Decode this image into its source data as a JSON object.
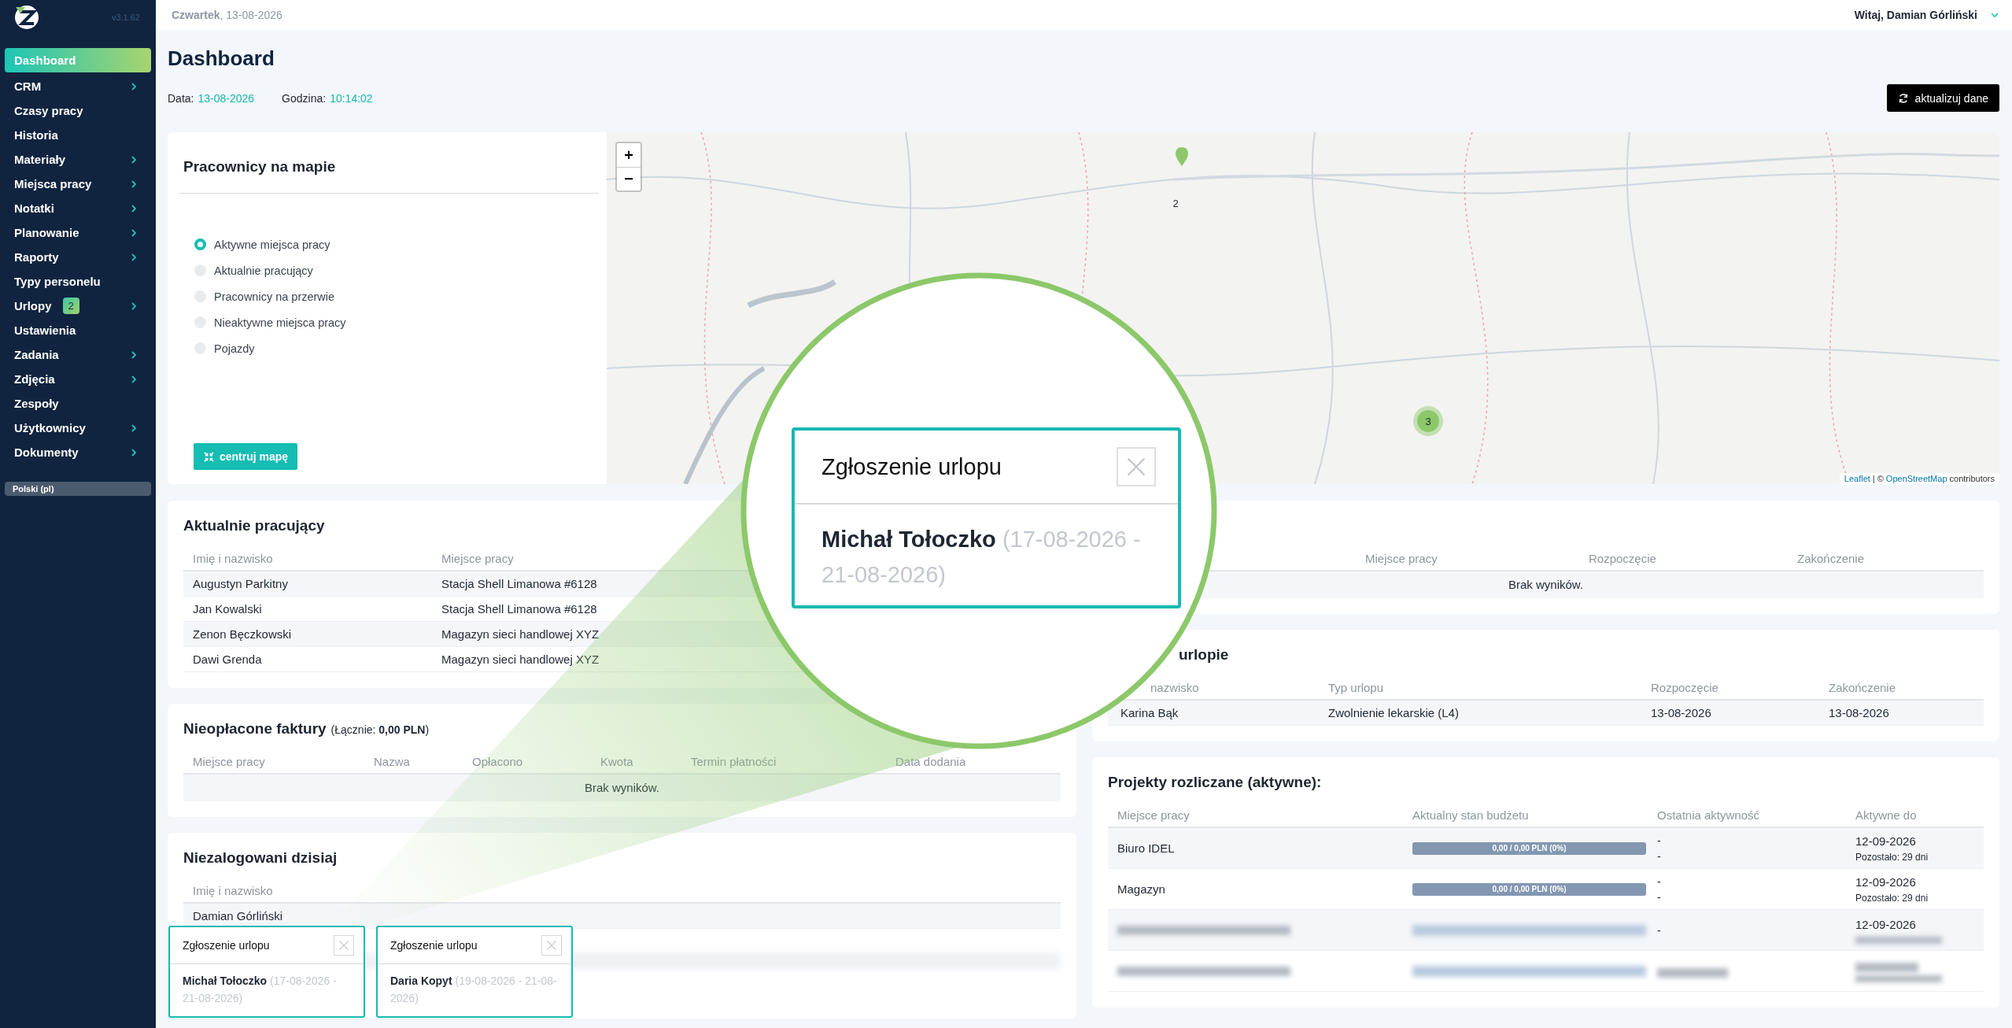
{
  "sidebar": {
    "version": "v3.1.62",
    "items": [
      {
        "label": "Dashboard",
        "selected": true,
        "submenu": false
      },
      {
        "label": "CRM",
        "selected": false,
        "submenu": true
      },
      {
        "label": "Czasy pracy",
        "selected": false,
        "submenu": false
      },
      {
        "label": "Historia",
        "selected": false,
        "submenu": false
      },
      {
        "label": "Materiały",
        "selected": false,
        "submenu": true
      },
      {
        "label": "Miejsca pracy",
        "selected": false,
        "submenu": true
      },
      {
        "label": "Notatki",
        "selected": false,
        "submenu": true
      },
      {
        "label": "Planowanie",
        "selected": false,
        "submenu": true
      },
      {
        "label": "Raporty",
        "selected": false,
        "submenu": true
      },
      {
        "label": "Typy personelu",
        "selected": false,
        "submenu": false
      },
      {
        "label": "Urlopy",
        "selected": false,
        "submenu": true,
        "badge": "2"
      },
      {
        "label": "Ustawienia",
        "selected": false,
        "submenu": false
      },
      {
        "label": "Zadania",
        "selected": false,
        "submenu": true
      },
      {
        "label": "Zdjęcia",
        "selected": false,
        "submenu": true
      },
      {
        "label": "Zespoły",
        "selected": false,
        "submenu": false
      },
      {
        "label": "Użytkownicy",
        "selected": false,
        "submenu": true
      },
      {
        "label": "Dokumenty",
        "selected": false,
        "submenu": true
      }
    ],
    "language": "Polski (pl)"
  },
  "topbar": {
    "date": "**Czwartek**, 13-08-2026",
    "greeting": "Witaj, Damian Górliński"
  },
  "page": {
    "title": "Dashboard",
    "date_label": "Data:",
    "date_value": "13-08-2026",
    "time_label": "Godzina:",
    "time_value": "10:14:02",
    "refresh_button": "aktualizuj dane"
  },
  "map_panel": {
    "title": "Pracownicy na mapie",
    "filters": [
      {
        "label": "Aktywne miejsca pracy",
        "selected": true
      },
      {
        "label": "Aktualnie pracujący",
        "selected": false
      },
      {
        "label": "Pracownicy na przerwie",
        "selected": false
      },
      {
        "label": "Nieaktywne miejsca pracy",
        "selected": false
      },
      {
        "label": "Pojazdy",
        "selected": false
      }
    ],
    "center_button": "centruj mapę",
    "zoom_in": "+",
    "zoom_out": "−",
    "markers": [
      {
        "kind": "pin"
      },
      {
        "kind": "label",
        "text": "2"
      },
      {
        "kind": "cluster",
        "text": "3"
      }
    ],
    "attribution": [
      {
        "text": "Leaflet",
        "link": true
      },
      {
        "text": "| ©",
        "link": false
      },
      {
        "text": "OpenStreetMap",
        "link": true
      },
      {
        "text": "contributors",
        "link": false
      }
    ]
  },
  "working_now": {
    "title": "Aktualnie pracujący",
    "columns": [
      "Imię i nazwisko",
      "Miejsce pracy"
    ],
    "rows": [
      [
        "Augustyn Parkitny",
        "Stacja Shell Limanowa #6128"
      ],
      [
        "Jan Kowalski",
        "Stacja Shell Limanowa #6128"
      ],
      [
        "Zenon Bęczkowski",
        "Magazyn sieci handlowej XYZ"
      ],
      [
        "Dawi Grenda",
        "Magazyn sieci handlowej XYZ"
      ]
    ]
  },
  "unpaid_invoices": {
    "title": "Nieopłacone faktury",
    "total": "(Łącznie: **0,00 PLN**)",
    "columns": [
      "Miejsce pracy",
      "Nazwa",
      "Opłacono",
      "Kwota",
      "Termin płatności",
      "Data dodania"
    ],
    "empty": "Brak wyników."
  },
  "not_logged_today": {
    "title": "Niezalogowani dzisiaj",
    "columns": [
      "Imię i nazwisko"
    ],
    "rows": [
      {
        "kind": "text",
        "name": "Damian Górliński"
      },
      {
        "kind": "blurred"
      }
    ]
  },
  "card_right_1": {
    "columns": [
      "Miejsce pracy",
      "Rozpoczęcie",
      "Zakończenie"
    ],
    "empty": "Brak wyników."
  },
  "on_leave": {
    "title": "urlopie",
    "columns": [
      "nazwisko",
      "Typ urlopu",
      "Rozpoczęcie",
      "Zakończenie"
    ],
    "rows": [
      [
        "Karina Bąk",
        "Zwolnienie lekarskie (L4)",
        "13-08-2026",
        "13-08-2026"
      ]
    ]
  },
  "projects": {
    "title": "Projekty rozliczane (aktywne):",
    "columns": [
      "Miejsce pracy",
      "Aktualny stan budżetu",
      "Ostatnia aktywność",
      "Aktywne do"
    ],
    "rows": [
      {
        "kind": "full",
        "place": "Biuro IDEL",
        "budget": "0,00 / 0,00 PLN (0%)",
        "level": 0,
        "activity": [
          "-",
          "-"
        ],
        "until": "12-09-2026",
        "remaining": "Pozostało: 29 dni"
      },
      {
        "kind": "full",
        "place": "Magazyn",
        "budget": "0,00 / 0,00 PLN (0%)",
        "level": 0,
        "activity": [
          "-",
          "-"
        ],
        "until": "12-09-2026",
        "remaining": "Pozostało: 29 dni"
      },
      {
        "kind": "blurred",
        "activity": [
          "-"
        ],
        "until": "12-09-2026"
      },
      {
        "kind": "blurred"
      }
    ]
  },
  "toasts": [
    {
      "title": "Zgłoszenie urlopu",
      "name": "Michał Tołoczko",
      "period": "(17-08-2026 - 21-08-2026)"
    },
    {
      "title": "Zgłoszenie urlopu",
      "name": "Daria Kopyt",
      "period": "(19-08-2026 - 21-08-2026)"
    }
  ],
  "magnifier": {
    "title": "Zgłoszenie urlopu",
    "name": "Michał Tołoczko",
    "period": "(17-08-2026 - 21-08-2026)"
  }
}
